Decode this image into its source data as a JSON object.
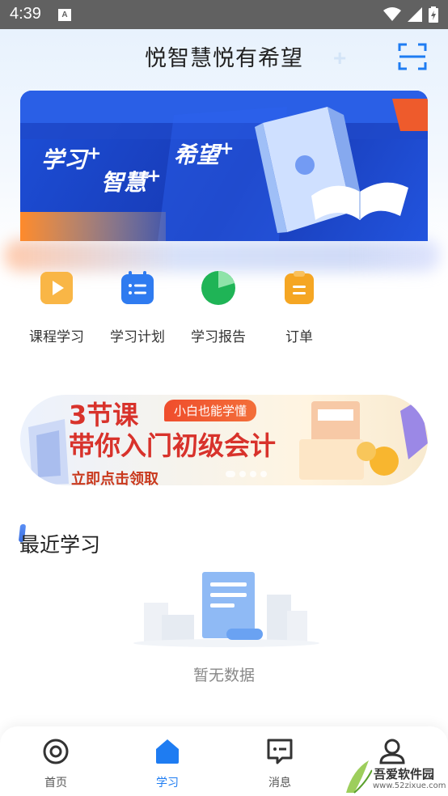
{
  "status_bar": {
    "time": "4:39",
    "notification_icon": "A"
  },
  "header": {
    "title": "悦智慧悦有希望",
    "scan_icon": "scan-icon"
  },
  "banner": {
    "text1": "学习",
    "text2": "智慧",
    "text3": "希望",
    "plus": "+"
  },
  "quick_menu": [
    {
      "label": "课程学习",
      "icon": "course-play-icon",
      "color": "#f5a623"
    },
    {
      "label": "学习计划",
      "icon": "calendar-plan-icon",
      "color": "#2f7bf0"
    },
    {
      "label": "学习报告",
      "icon": "pie-report-icon",
      "color": "#1fb456"
    },
    {
      "label": "订单",
      "icon": "order-clipboard-icon",
      "color": "#f5a623"
    }
  ],
  "promo": {
    "title_line1": "3节课",
    "tag": "小白也能学懂",
    "title_line2": "带你入门初级会计",
    "cta": "立即点击领取"
  },
  "recent": {
    "title": "最近学习",
    "empty_text": "暂无数据"
  },
  "tabbar": [
    {
      "label": "首页",
      "icon": "home-target-icon",
      "active": false
    },
    {
      "label": "学习",
      "icon": "study-house-icon",
      "active": true
    },
    {
      "label": "消息",
      "icon": "message-icon",
      "active": false
    },
    {
      "label": "",
      "icon": "profile-icon",
      "active": false
    }
  ],
  "watermark": {
    "text": "吾爱软件园",
    "url": "www.52zixue.com"
  },
  "colors": {
    "accent": "#1e7cf2",
    "banner_blue": "#1d4fd8",
    "promo_red": "#d8322b"
  }
}
